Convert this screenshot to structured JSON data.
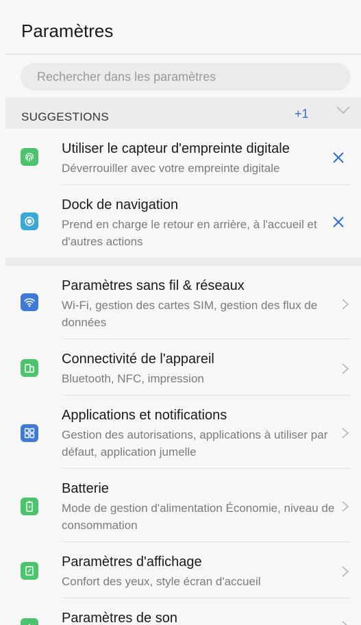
{
  "header": {
    "title": "Paramètres"
  },
  "search": {
    "placeholder": "Rechercher dans les paramètres"
  },
  "suggestions": {
    "label": "SUGGESTIONS",
    "count": "+1",
    "items": [
      {
        "title": "Utiliser le capteur d'empreinte digitale",
        "subtitle": "Déverrouiller avec votre empreinte digitale",
        "icon": "fingerprint-icon",
        "color": "#4cc36c"
      },
      {
        "title": "Dock de navigation",
        "subtitle": "Prend en charge le retour en arrière, à l'accueil et d'autres actions",
        "icon": "navigation-dock-icon",
        "color": "#3aa7d6"
      }
    ]
  },
  "settings": [
    {
      "title": "Paramètres sans fil & réseaux",
      "subtitle": "Wi-Fi, gestion des cartes SIM, gestion des flux de données",
      "icon": "wifi-icon",
      "color": "#3f7ad6"
    },
    {
      "title": "Connectivité de l'appareil",
      "subtitle": "Bluetooth, NFC, impression",
      "icon": "device-connectivity-icon",
      "color": "#4cc36c"
    },
    {
      "title": "Applications et notifications",
      "subtitle": "Gestion des autorisations, applications à utiliser par défaut, application jumelle",
      "icon": "apps-grid-icon",
      "color": "#3f7ad6"
    },
    {
      "title": "Batterie",
      "subtitle": "Mode de gestion d'alimentation Économie, niveau de consommation",
      "icon": "battery-icon",
      "color": "#4cc36c"
    },
    {
      "title": "Paramètres d'affichage",
      "subtitle": "Confort des yeux, style écran d'accueil",
      "icon": "display-icon",
      "color": "#4cc36c"
    },
    {
      "title": "Paramètres de son",
      "subtitle": "",
      "icon": "sound-icon",
      "color": "#4cc36c"
    }
  ],
  "colors": {
    "accent": "#2f6fd2",
    "green": "#4cc36c",
    "blue": "#3f7ad6"
  }
}
